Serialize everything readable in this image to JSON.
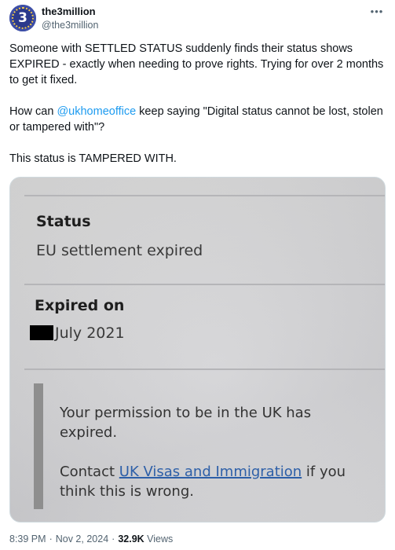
{
  "account": {
    "display_name": "the3million",
    "handle": "@the3million",
    "avatar_text": "3",
    "avatar_color": "#2b3a8c"
  },
  "more_icon": "more-horizontal-icon",
  "tweet": {
    "para1": "Someone with SETTLED STATUS suddenly finds their status shows EXPIRED - exactly when needing to prove rights. Trying for over 2 months to get it fixed.",
    "para2_before": "How can ",
    "para2_mention": "@ukhomeoffice",
    "para2_after": " keep saying \"Digital status cannot be lost, stolen or tampered with\"?",
    "para3": "This status is TAMPERED WITH."
  },
  "photo": {
    "status_heading": "Status",
    "status_value": "EU settlement expired",
    "expired_heading": "Expired on",
    "expired_value": "July 2021",
    "notice_text": "Your permission to be in the UK has expired.",
    "contact_before": "Contact ",
    "contact_link": "UK Visas and Immigration",
    "contact_after": " if you think this is wrong."
  },
  "footer": {
    "time": "8:39 PM",
    "date": "Nov 2, 2024",
    "views_count": "32.9K",
    "views_label": "Views"
  },
  "colors": {
    "link": "#1d9bf0",
    "secondary_text": "#536471",
    "primary_text": "#0f1419"
  }
}
